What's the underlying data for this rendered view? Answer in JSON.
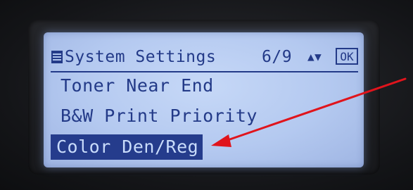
{
  "screen": {
    "header": {
      "title": "System Settings",
      "page_indicator": "6/9",
      "scroll_symbol": "▲▼",
      "ok_label": "OK"
    },
    "menu_items": [
      {
        "label": "Toner Near End",
        "selected": false
      },
      {
        "label": "B&W Print Priority",
        "selected": false
      },
      {
        "label": "Color Den/Reg",
        "selected": true
      }
    ]
  },
  "annotation": {
    "arrow_color": "#e0141c"
  },
  "colors": {
    "lcd_background": "#b4c9f0",
    "lcd_text": "#233a88",
    "highlight_background": "#253c8c",
    "highlight_text": "#c9dcfb"
  }
}
